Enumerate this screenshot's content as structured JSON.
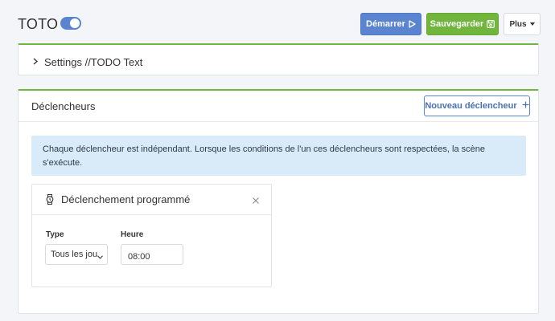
{
  "header": {
    "title": "TOTO",
    "toggle_on": true,
    "start_label": "Démarrer",
    "save_label": "Sauvegarder",
    "more_label": "Plus"
  },
  "settings": {
    "label": "Settings //TODO Text"
  },
  "triggers": {
    "title": "Déclencheurs",
    "new_button_label": "Nouveau déclencheur",
    "info_text": "Chaque déclencheur est indépendant. Lorsque les conditions de l'un ces déclencheurs sont respectées, la scène s'exécute.",
    "items": [
      {
        "name": "Déclenchement programmé",
        "type_label": "Type",
        "type_value": "Tous les jours",
        "hour_label": "Heure",
        "hour_value": "08:00"
      }
    ]
  },
  "colors": {
    "primary": "#5a84cf",
    "success": "#71b53c",
    "info_bg": "#d9ebf9"
  },
  "icons": [
    "play-icon",
    "save-icon",
    "caret-down-icon",
    "chevron-right-icon",
    "plus-icon",
    "watch-icon",
    "close-icon",
    "select-chevron-icon"
  ]
}
